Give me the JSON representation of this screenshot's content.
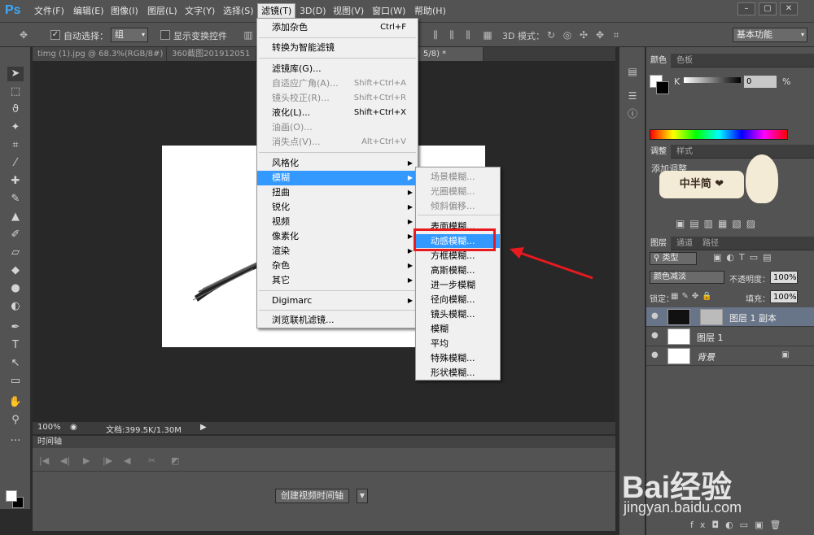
{
  "app": {
    "logo": "Ps"
  },
  "menubar": {
    "items": [
      "文件(F)",
      "编辑(E)",
      "图像(I)",
      "图层(L)",
      "文字(Y)",
      "选择(S)",
      "滤镜(T)",
      "3D(D)",
      "视图(V)",
      "窗口(W)",
      "帮助(H)"
    ],
    "window_controls": [
      "–",
      "▢",
      "✕"
    ]
  },
  "options_bar": {
    "auto_select_label": "自动选择：",
    "auto_select_value": "组",
    "show_transform_label": "显示变换控件",
    "mode_3d_label": "3D 模式：",
    "workspace": "基本功能"
  },
  "tabs": [
    {
      "label": "timg (1).jpg @ 68.3%(RGB/8#) *",
      "active": false
    },
    {
      "label": "360截图201912051",
      "active": false
    },
    {
      "label": "5/8) *",
      "active": true
    }
  ],
  "filter_menu": {
    "items": [
      {
        "label": "添加杂色",
        "shortcut": "Ctrl+F",
        "disabled": false
      },
      {
        "label": "转换为智能滤镜",
        "shortcut": "",
        "disabled": false
      },
      {
        "label": "滤镜库(G)...",
        "shortcut": "",
        "disabled": false
      },
      {
        "label": "自适应广角(A)...",
        "shortcut": "Shift+Ctrl+A",
        "disabled": true
      },
      {
        "label": "镜头校正(R)...",
        "shortcut": "Shift+Ctrl+R",
        "disabled": true
      },
      {
        "label": "液化(L)...",
        "shortcut": "Shift+Ctrl+X",
        "disabled": false
      },
      {
        "label": "油画(O)...",
        "shortcut": "",
        "disabled": true
      },
      {
        "label": "消失点(V)...",
        "shortcut": "Alt+Ctrl+V",
        "disabled": true
      },
      {
        "label": "风格化",
        "shortcut": "",
        "disabled": false,
        "submenu": true
      },
      {
        "label": "模糊",
        "shortcut": "",
        "disabled": false,
        "submenu": true,
        "highlighted": true
      },
      {
        "label": "扭曲",
        "shortcut": "",
        "disabled": false,
        "submenu": true
      },
      {
        "label": "锐化",
        "shortcut": "",
        "disabled": false,
        "submenu": true
      },
      {
        "label": "视频",
        "shortcut": "",
        "disabled": false,
        "submenu": true
      },
      {
        "label": "像素化",
        "shortcut": "",
        "disabled": false,
        "submenu": true
      },
      {
        "label": "渲染",
        "shortcut": "",
        "disabled": false,
        "submenu": true
      },
      {
        "label": "杂色",
        "shortcut": "",
        "disabled": false,
        "submenu": true
      },
      {
        "label": "其它",
        "shortcut": "",
        "disabled": false,
        "submenu": true
      },
      {
        "label": "Digimarc",
        "shortcut": "",
        "disabled": false,
        "submenu": true
      },
      {
        "label": "浏览联机滤镜...",
        "shortcut": "",
        "disabled": false
      }
    ]
  },
  "blur_submenu": {
    "items": [
      {
        "label": "场景模糊...",
        "disabled": true
      },
      {
        "label": "光圈模糊...",
        "disabled": true
      },
      {
        "label": "倾斜偏移...",
        "disabled": true
      },
      {
        "label": "表面模糊...",
        "disabled": false
      },
      {
        "label": "动感模糊...",
        "disabled": false,
        "highlighted": true
      },
      {
        "label": "方框模糊...",
        "disabled": false
      },
      {
        "label": "高斯模糊...",
        "disabled": false
      },
      {
        "label": "进一步模糊",
        "disabled": false
      },
      {
        "label": "径向模糊...",
        "disabled": false
      },
      {
        "label": "镜头模糊...",
        "disabled": false
      },
      {
        "label": "模糊",
        "disabled": false
      },
      {
        "label": "平均",
        "disabled": false
      },
      {
        "label": "特殊模糊...",
        "disabled": false
      },
      {
        "label": "形状模糊...",
        "disabled": false
      }
    ]
  },
  "status": {
    "zoom": "100%",
    "doc_info": "文档:399.5K/1.30M"
  },
  "timeline": {
    "title": "时间轴",
    "create_button": "创建视频时间轴"
  },
  "color_panel": {
    "tabs": [
      "颜色",
      "色板"
    ],
    "channel": "K",
    "value": "0",
    "unit": "%"
  },
  "adjust_panel": {
    "tabs": [
      "调整",
      "样式"
    ],
    "title": "添加调整"
  },
  "sticker": {
    "text": "中半简 ❤"
  },
  "layers_panel": {
    "tabs": [
      "图层",
      "通道",
      "路径"
    ],
    "filter_kind": "类型",
    "blend_mode": "颜色减淡",
    "opacity_label": "不透明度：",
    "opacity": "100%",
    "lock_label": "锁定：",
    "fill_label": "填充：",
    "fill": "100%",
    "layers": [
      {
        "name": "图层 1 副本",
        "selected": true
      },
      {
        "name": "图层 1",
        "selected": false
      },
      {
        "name": "背景",
        "selected": false
      }
    ]
  },
  "watermark": {
    "brand": "Bai经验",
    "url": "jingyan.baidu.com"
  },
  "colors": {
    "highlight": "#3399ff",
    "annotation": "#e8191f",
    "ps_blue": "#3fa9f5"
  }
}
